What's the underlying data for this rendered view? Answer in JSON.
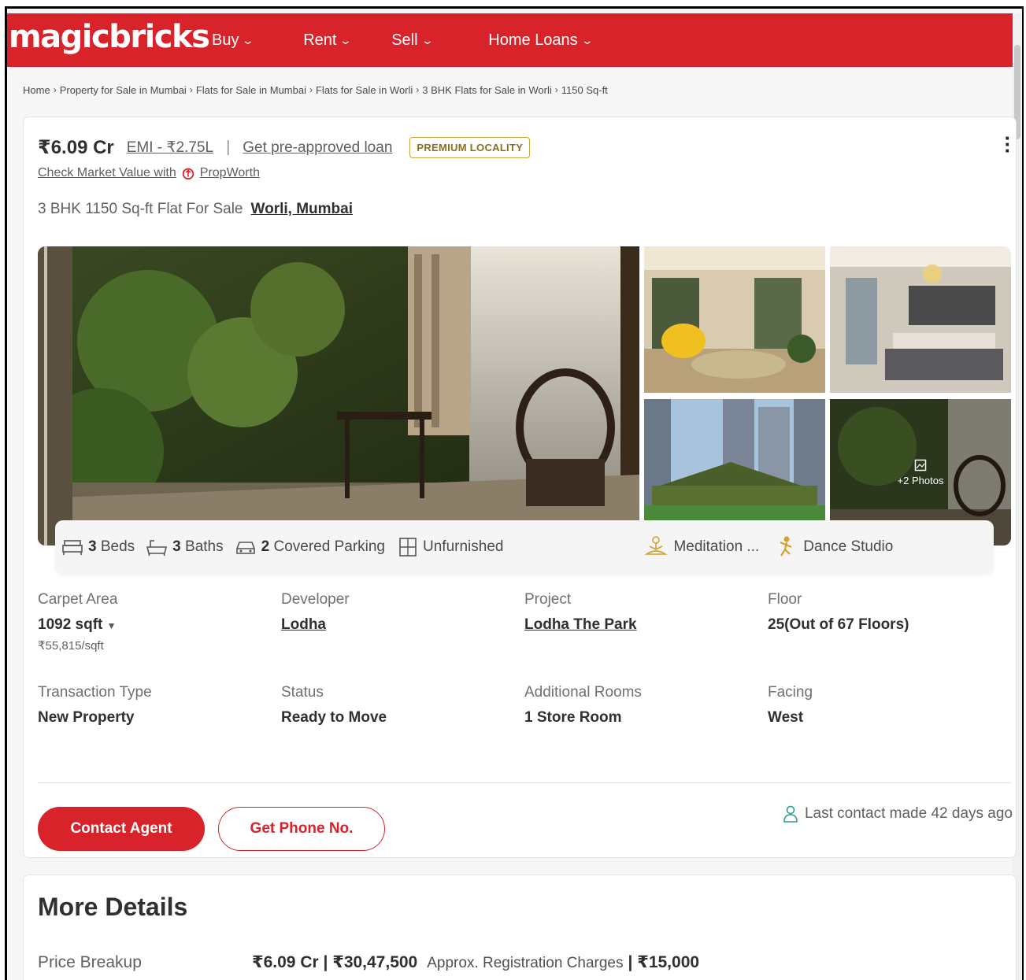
{
  "header": {
    "logo": "magicbricks",
    "nav": [
      {
        "label": "Buy"
      },
      {
        "label": "Rent"
      },
      {
        "label": "Sell"
      },
      {
        "label": "Home Loans"
      }
    ]
  },
  "breadcrumb": [
    "Home",
    "Property for Sale in Mumbai",
    "Flats for Sale in Mumbai",
    "Flats for Sale in Worli",
    "3 BHK Flats for Sale in Worli",
    "1150 Sq-ft"
  ],
  "listing": {
    "price": "₹6.09 Cr",
    "emi": "EMI - ₹2.75L",
    "separator": "|",
    "loan_link": "Get pre-approved loan",
    "badge": "PREMIUM LOCALITY",
    "market_value_text": "Check Market Value with",
    "propworth": "PropWorth",
    "title": "3 BHK 1150 Sq-ft Flat For Sale",
    "location": "Worli, Mumbai",
    "more_photos": "+2 Photos",
    "amenities": {
      "beds_count": "3",
      "beds": "Beds",
      "baths_count": "3",
      "baths": "Baths",
      "parking_count": "2",
      "parking": "Covered Parking",
      "furnishing": "Unfurnished",
      "meditation": "Meditation ...",
      "dance": "Dance Studio"
    },
    "specs": {
      "carpet_label": "Carpet Area",
      "carpet_value": "1092 sqft",
      "carpet_rate": "₹55,815/sqft",
      "developer_label": "Developer",
      "developer_value": "Lodha",
      "project_label": "Project",
      "project_value": "Lodha The Park",
      "floor_label": "Floor",
      "floor_value": "25(Out of 67 Floors)",
      "transaction_label": "Transaction Type",
      "transaction_value": "New Property",
      "status_label": "Status",
      "status_value": "Ready to Move",
      "rooms_label": "Additional Rooms",
      "rooms_value": "1 Store Room",
      "facing_label": "Facing",
      "facing_value": "West"
    },
    "contact_button": "Contact Agent",
    "phone_button": "Get Phone No.",
    "last_contact": "Last contact made 42 days ago"
  },
  "more_details": {
    "title": "More Details",
    "price_breakup_label": "Price Breakup",
    "price_breakup_value": "₹6.09 Cr | ₹30,47,500",
    "registration_note": "Approx. Registration Charges",
    "registration_value": "| ₹15,000"
  },
  "colors": {
    "brand_red": "#d8232a",
    "premium_gold": "#c9a43b"
  }
}
